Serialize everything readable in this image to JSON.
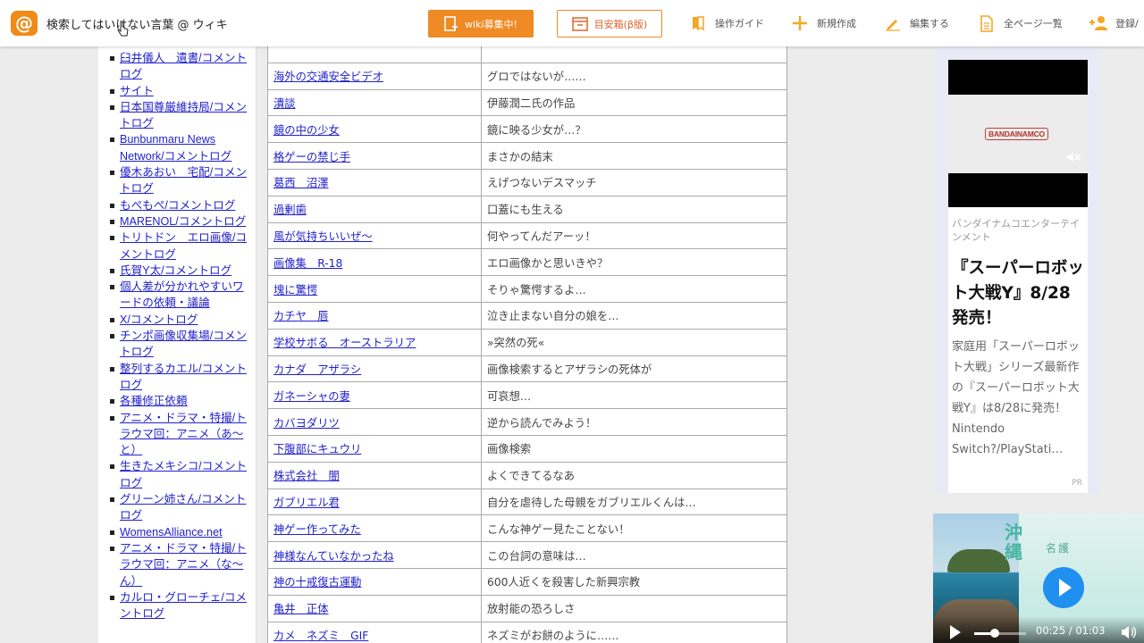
{
  "header": {
    "site_title": "検索してはいけない言葉 @ ウィキ",
    "recruit_label": "wiki募集中!",
    "box_label": "目安箱(β版)",
    "nav": [
      {
        "label": "操作ガイド",
        "icon": "bookmark-icon"
      },
      {
        "label": "新規作成",
        "icon": "plus-icon"
      },
      {
        "label": "編集する",
        "icon": "pencil-icon"
      },
      {
        "label": "全ページ一覧",
        "icon": "document-icon"
      },
      {
        "label": "登録/",
        "icon": "users-icon"
      }
    ]
  },
  "sidebar": {
    "items": [
      "臼井儀人　遺書/コメントログ",
      "サイト",
      "日本国尊厳維持局/コメントログ",
      "Bunbunmaru News Network/コメントログ",
      "優木あおい　宅配/コメントログ",
      "もぺもぺ/コメントログ",
      "MARENOL/コメントログ",
      "トリトドン　エロ画像/コメントログ",
      "氏賀Y太/コメントログ",
      "個人差が分かれやすいワードの依頼・議論",
      "X/コメントログ",
      "チンポ画像収集場/コメントログ",
      "整列するカエル/コメントログ",
      "各種修正依頼",
      "アニメ・ドラマ・特撮/トラウマ回：アニメ（あ～と）",
      "生きたメキシコ/コメントログ",
      "グリーン姉さん/コメントログ",
      "WomensAlliance.net",
      "アニメ・ドラマ・特撮/トラウマ回：アニメ（な～ん）",
      "カルロ・グローチェ/コメントログ"
    ]
  },
  "table": {
    "rows": [
      {
        "word": "",
        "note": ""
      },
      {
        "word": "海外の交通安全ビデオ",
        "note": "グロではないが……"
      },
      {
        "word": "潰談",
        "note": "伊藤潤二氏の作品"
      },
      {
        "word": "鏡の中の少女",
        "note": "鏡に映る少女が…？"
      },
      {
        "word": "格ゲーの禁じ手",
        "note": "まさかの結末"
      },
      {
        "word": "葛西　沼澤",
        "note": "えげつないデスマッチ"
      },
      {
        "word": "過剰歯",
        "note": "口蓋にも生える"
      },
      {
        "word": "風が気持ちいいぜ～",
        "note": "何やってんだアーッ！"
      },
      {
        "word": "画像集　R-18",
        "note": "エロ画像かと思いきや？"
      },
      {
        "word": "塊に驚愕",
        "note": "そりゃ驚愕するよ…"
      },
      {
        "word": "カチヤ　唇",
        "note": "泣き止まない自分の娘を…"
      },
      {
        "word": "学校サボる　オーストラリア",
        "note": "»突然の死«"
      },
      {
        "word": "カナダ　アザラシ",
        "note": "画像検索するとアザラシの死体が"
      },
      {
        "word": "ガネーシャの妻",
        "note": "可哀想…"
      },
      {
        "word": "カバヨダリツ",
        "note": "逆から読んでみよう！"
      },
      {
        "word": "下腹部にキュウリ",
        "note": "画像検索"
      },
      {
        "word": "株式会社　闇",
        "note": "よくできてるなあ"
      },
      {
        "word": "ガブリエル君",
        "note": "自分を虐待した母親をガブリエルくんは…"
      },
      {
        "word": "神ゲー作ってみた",
        "note": "こんな神ゲー見たことない！"
      },
      {
        "word": "神様なんていなかったね",
        "note": "この台詞の意味は…"
      },
      {
        "word": "神の十戒復古運動",
        "note": "600人近くを殺害した新興宗教"
      },
      {
        "word": "亀井　正体",
        "note": "放射能の恐ろしさ"
      },
      {
        "word": "カメ　ネズミ　GIF",
        "note": "ネズミがお餅のように……"
      },
      {
        "word": "",
        "note": ""
      }
    ]
  },
  "ad": {
    "brand": "BANDAINAMCO",
    "company": "バンダイナムコエンターテインメント",
    "headline": "『スーパーロボット大戦Y』8/28発売！",
    "body": "家庭用「スーパーロボット大戦」シリーズ最新作の『スーパーロボット大戦Y』は8/28に発売！Nintendo Switch?/PlayStati…",
    "pr": "PR"
  },
  "player": {
    "title_vertical": "沖縄",
    "subtitle": "名護",
    "time": "00:25 / 01:03",
    "progress": 0.4
  }
}
